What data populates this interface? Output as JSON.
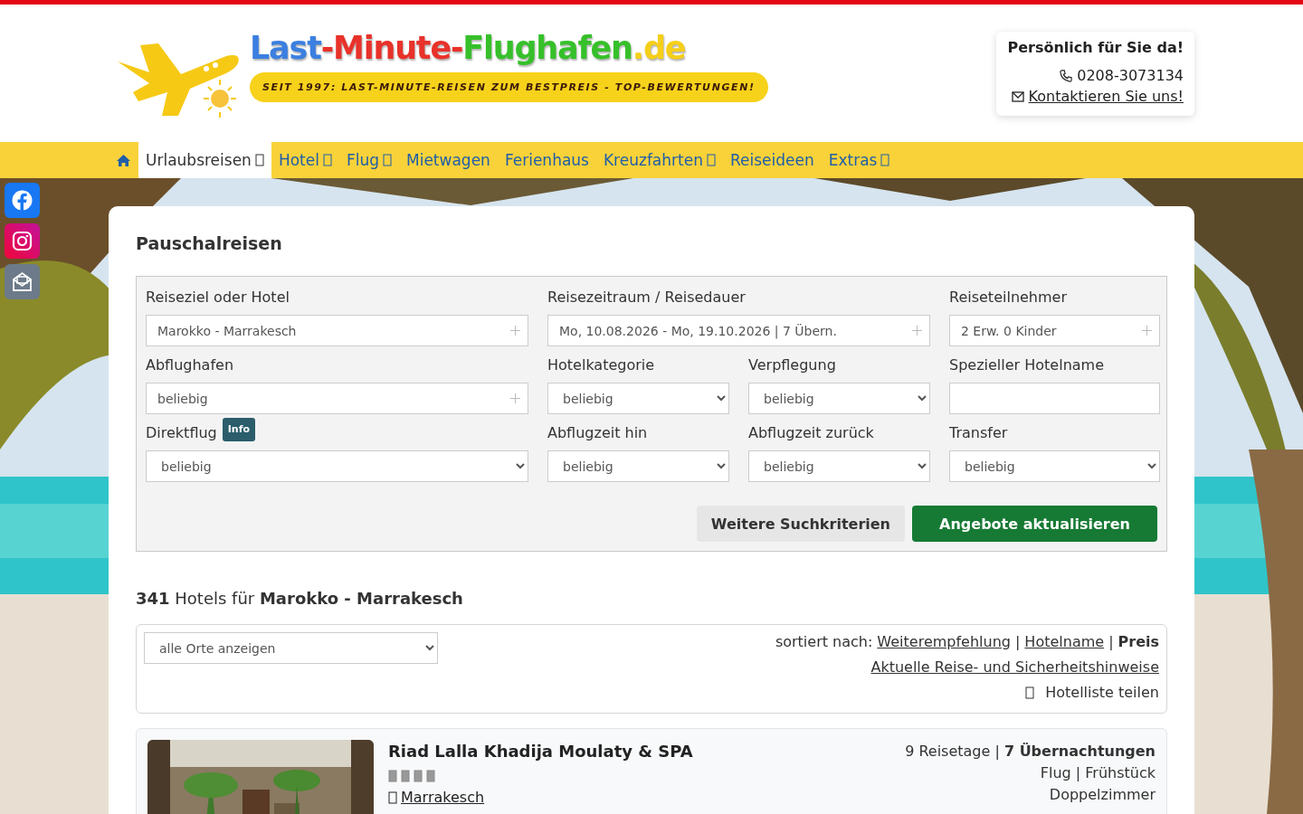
{
  "logo": {
    "parts": [
      {
        "text": "Last",
        "color": "#3b7fe0"
      },
      {
        "text": "-Minute-",
        "color": "#e8322a"
      },
      {
        "text": "Flughafen",
        "color": "#36c02a"
      },
      {
        "text": ".de",
        "color": "#f5cf18"
      }
    ],
    "tagline": "SEIT 1997: LAST-MINUTE-REISEN ZUM BESTPREIS - TOP-BEWERTUNGEN!"
  },
  "contact": {
    "title": "Persönlich für Sie da!",
    "phone": "0208-3073134",
    "link": "Kontaktieren Sie uns!"
  },
  "nav": [
    {
      "label": "Urlaubsreisen",
      "selected": true,
      "has_menu": true
    },
    {
      "label": "Hotel",
      "selected": false,
      "has_menu": true
    },
    {
      "label": "Flug",
      "selected": false,
      "has_menu": true
    },
    {
      "label": "Mietwagen",
      "selected": false,
      "has_menu": false
    },
    {
      "label": "Ferienhaus",
      "selected": false,
      "has_menu": false
    },
    {
      "label": "Kreuzfahrten",
      "selected": false,
      "has_menu": true
    },
    {
      "label": "Reiseideen",
      "selected": false,
      "has_menu": false
    },
    {
      "label": "Extras",
      "selected": false,
      "has_menu": true
    }
  ],
  "social": [
    {
      "kind": "facebook"
    },
    {
      "kind": "instagram"
    },
    {
      "kind": "newsletter"
    }
  ],
  "search": {
    "title": "Pauschalreisen",
    "fields": [
      {
        "label": "Reiseziel oder Hotel",
        "kind": "picker",
        "value": "Marokko - Marrakesch"
      },
      {
        "label": "Reisezeitraum / Reisedauer",
        "kind": "picker",
        "value": "Mo, 10.08.2026 - Mo, 19.10.2026 | 7 Übern."
      },
      {
        "label": "Reiseteilnehmer",
        "kind": "picker",
        "value": "2 Erw. 0 Kinder"
      },
      {
        "label": "Abflughafen",
        "kind": "picker",
        "value": "beliebig"
      },
      {
        "label": "Hotelkategorie",
        "kind": "select",
        "value": "beliebig"
      },
      {
        "label": "Verpflegung",
        "kind": "select",
        "value": "beliebig"
      },
      {
        "label": "Spezieller Hotelname",
        "kind": "text"
      },
      {
        "label": "Direktflug",
        "badge": "Info",
        "kind": "select",
        "value": "beliebig"
      },
      {
        "label": "Abflugzeit hin",
        "kind": "select",
        "value": "beliebig"
      },
      {
        "label": "Abflugzeit zurück",
        "kind": "select",
        "value": "beliebig"
      },
      {
        "label": "Transfer",
        "kind": "select",
        "value": "beliebig"
      }
    ],
    "buttons": [
      {
        "label": "Weitere Suchkriterien",
        "kind": "secondary"
      },
      {
        "label": "Angebote aktualisieren",
        "kind": "primary"
      }
    ]
  },
  "results": {
    "heading": "**341** Hotels für **Marokko - Marrakesch**",
    "location_filter": "alle Orte anzeigen",
    "sort_label": "sortiert nach:",
    "sort_options": [
      {
        "label": "Weiterempfehlung",
        "selected": false
      },
      {
        "label": "Hotelname",
        "selected": false
      },
      {
        "label": "Preis",
        "selected": true
      }
    ],
    "sort_separator": "|",
    "notice_link": "Aktuelle Reise- und Sicherheitshinweise",
    "share": "Hotelliste teilen"
  },
  "hotels": [
    {
      "name": "Riad Lalla Khadija Moulaty & SPA",
      "stars": 4,
      "location": "Marrakesch",
      "duration": "9 Reisetage | **7 Übernachtungen**",
      "board": "Flug | Frühstück",
      "room": "Doppelzimmer"
    }
  ]
}
